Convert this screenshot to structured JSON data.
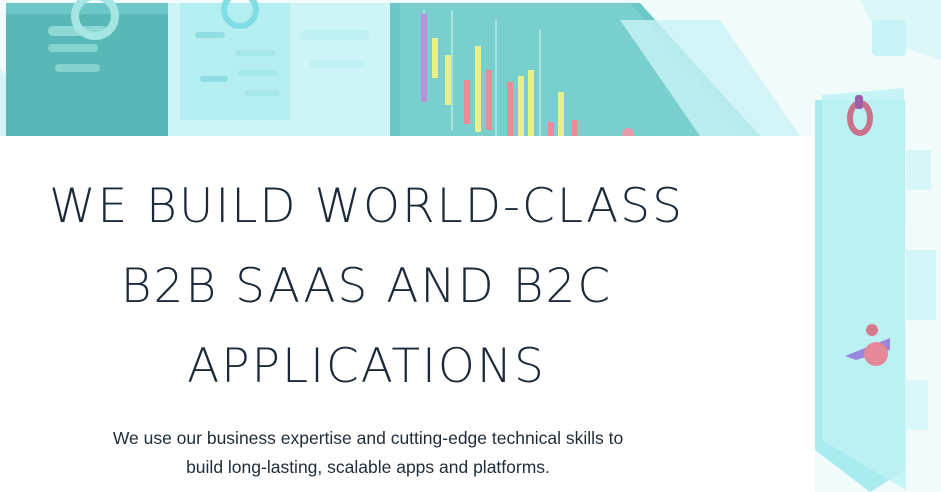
{
  "hero": {
    "title_lines": [
      "WE BUILD WORLD-CLASS",
      "B2B SAAS AND B2C",
      "APPLICATIONS"
    ],
    "subtitle_lines": [
      "We use our business expertise and cutting-edge technical skills to",
      "build long-lasting, scalable apps and platforms."
    ]
  },
  "illustration": {
    "theme_colors": {
      "panel_dark": "#5cbcbc",
      "panel_light": "#bdf2f4",
      "panel_cyan": "#8fe6ec",
      "accent_pink": "#e9889a",
      "accent_yellow": "#e7ee8a",
      "accent_purple": "#a896e0",
      "title_text": "#1b2a3a"
    },
    "icons": [
      "dashboard-panel-icon",
      "bar-chart-panel-icon",
      "ring-marker-icon",
      "person-figure-icon"
    ]
  }
}
